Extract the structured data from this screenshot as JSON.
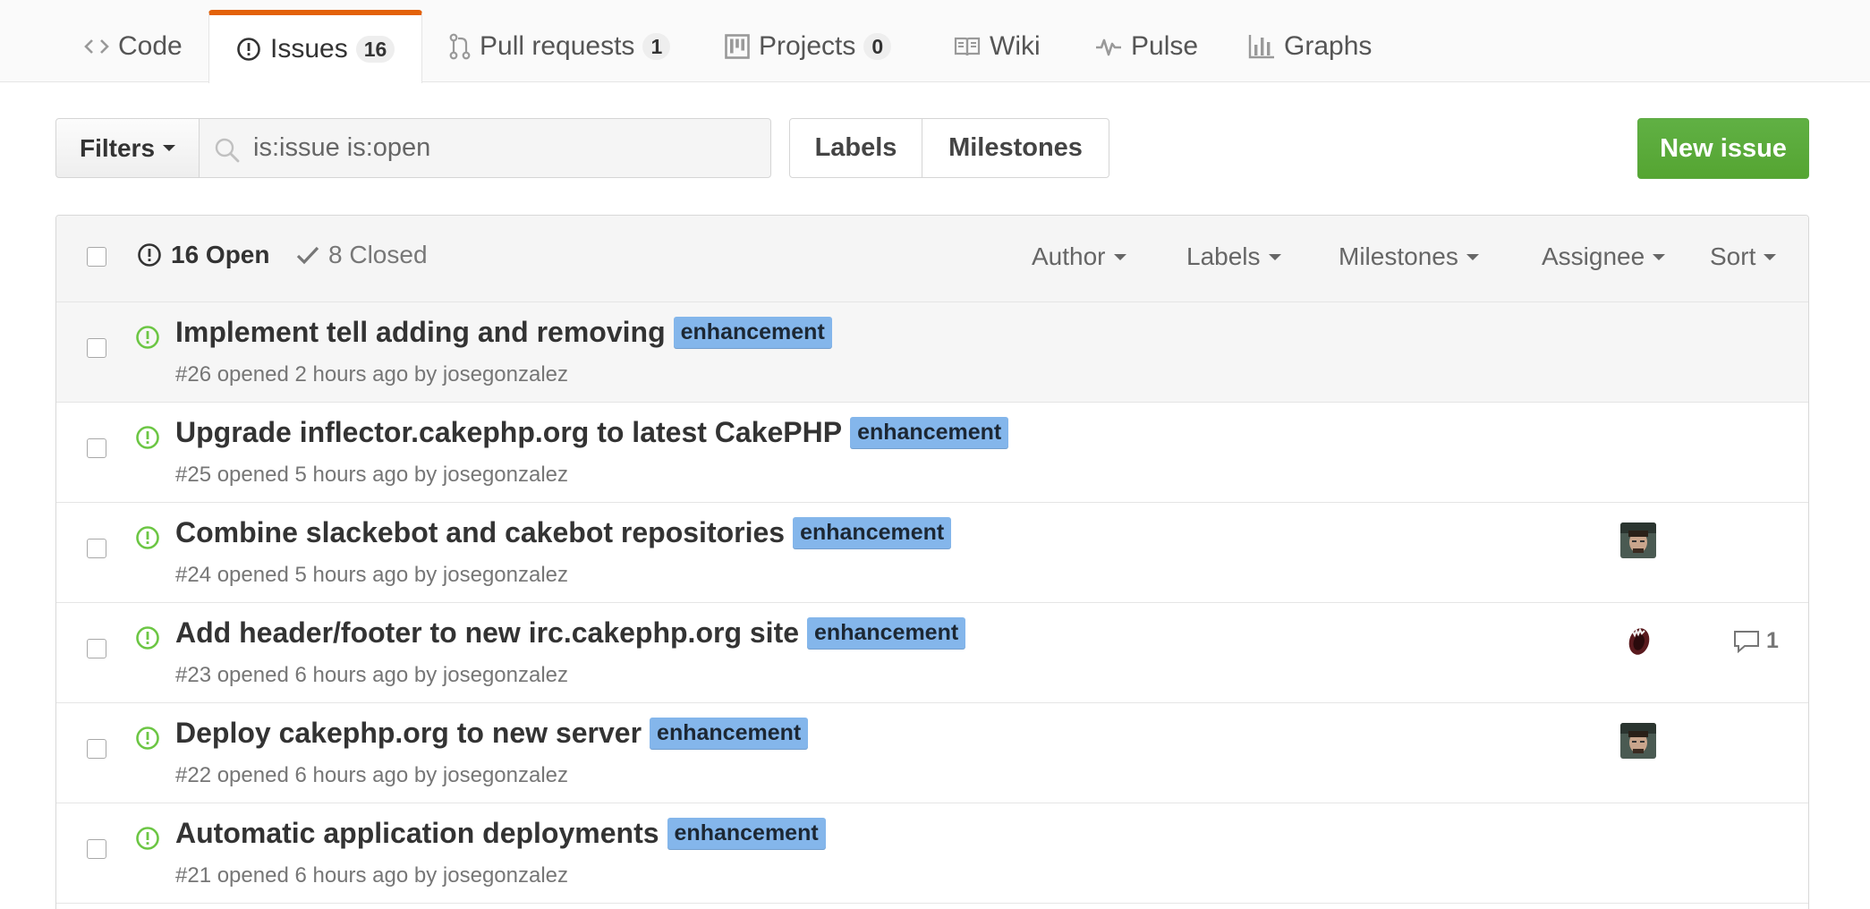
{
  "nav": {
    "tabs": [
      {
        "label": "Code",
        "icon": "code-icon",
        "count": null
      },
      {
        "label": "Issues",
        "icon": "issue-opened-icon",
        "count": "16",
        "selected": true
      },
      {
        "label": "Pull requests",
        "icon": "git-pull-request-icon",
        "count": "1"
      },
      {
        "label": "Projects",
        "icon": "project-icon",
        "count": "0"
      },
      {
        "label": "Wiki",
        "icon": "book-icon",
        "count": null
      },
      {
        "label": "Pulse",
        "icon": "pulse-icon",
        "count": null
      },
      {
        "label": "Graphs",
        "icon": "graph-icon",
        "count": null
      }
    ]
  },
  "subnav": {
    "filters_label": "Filters",
    "search_value": "is:issue is:open",
    "labels_label": "Labels",
    "milestones_label": "Milestones",
    "new_issue_label": "New issue"
  },
  "header": {
    "open_label": "16 Open",
    "closed_label": "8 Closed",
    "filters": [
      "Author",
      "Labels",
      "Milestones",
      "Assignee",
      "Sort"
    ]
  },
  "issues": [
    {
      "title": "Implement tell adding and removing",
      "label": "enhancement",
      "meta": "#26 opened 2 hours ago by josegonzalez",
      "assignee": null,
      "comments": null
    },
    {
      "title": "Upgrade inflector.cakephp.org to latest CakePHP",
      "label": "enhancement",
      "meta": "#25 opened 5 hours ago by josegonzalez",
      "assignee": null,
      "comments": null
    },
    {
      "title": "Combine slackebot and cakebot repositories",
      "label": "enhancement",
      "meta": "#24 opened 5 hours ago by josegonzalez",
      "assignee": "avatar-person",
      "comments": null
    },
    {
      "title": "Add header/footer to new irc.cakephp.org site",
      "label": "enhancement",
      "meta": "#23 opened 6 hours ago by josegonzalez",
      "assignee": "avatar-mouth",
      "comments": "1"
    },
    {
      "title": "Deploy cakephp.org to new server",
      "label": "enhancement",
      "meta": "#22 opened 6 hours ago by josegonzalez",
      "assignee": "avatar-person",
      "comments": null
    },
    {
      "title": "Automatic application deployments",
      "label": "enhancement",
      "meta": "#21 opened 6 hours ago by josegonzalez",
      "assignee": null,
      "comments": null
    }
  ],
  "colors": {
    "accent_tab": "#e36209",
    "open_green": "#6cc644",
    "label_blue": "#84b6eb",
    "button_green": "#5ca941"
  }
}
